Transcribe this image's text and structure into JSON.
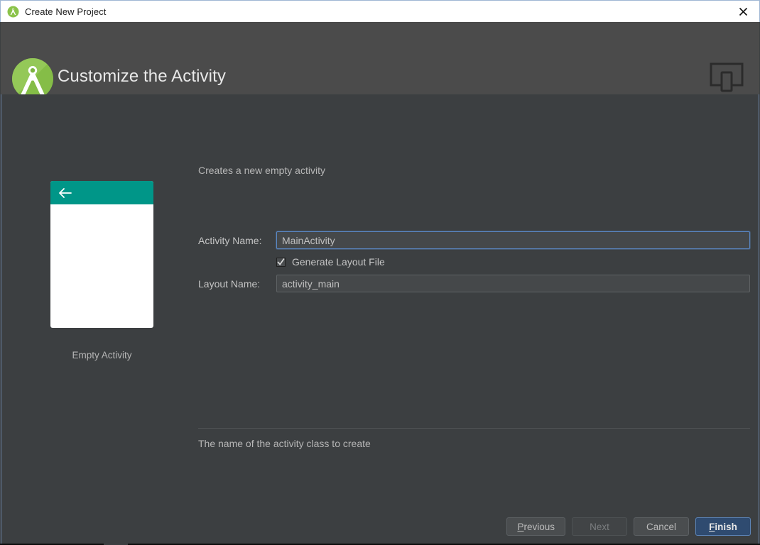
{
  "titlebar": {
    "title": "Create New Project",
    "app_icon": "android-studio-icon",
    "close_icon": "close-icon"
  },
  "header": {
    "title": "Customize the Activity",
    "logo_icon": "android-studio-logo",
    "device_icon": "device-preview-icon"
  },
  "preview": {
    "back_icon": "back-arrow-icon",
    "label": "Empty Activity",
    "appbar_color": "#009688"
  },
  "form": {
    "description": "Creates a new empty activity",
    "activity_name": {
      "label": "Activity Name:",
      "value": "MainActivity",
      "placeholder": "Activity Name"
    },
    "generate_layout": {
      "label": "Generate Layout File",
      "checked": true,
      "icon": "checkbox-checked-icon"
    },
    "layout_name": {
      "label": "Layout Name:",
      "value": "activity_main",
      "placeholder": "Layout Name"
    },
    "help_text": "The name of the activity class to create"
  },
  "buttons": {
    "previous": {
      "label": "Previous",
      "mnemonic": "P"
    },
    "next": {
      "label": "Next",
      "disabled": true
    },
    "cancel": {
      "label": "Cancel"
    },
    "finish": {
      "label": "Finish",
      "mnemonic": "F",
      "primary": true
    }
  },
  "colors": {
    "accent_blue": "#5a87c4",
    "primary_button": "#2f4b70",
    "teal": "#009688",
    "android_green": "#7cb342",
    "body_bg": "#3c3f41",
    "header_bg": "#4b4b4b"
  }
}
